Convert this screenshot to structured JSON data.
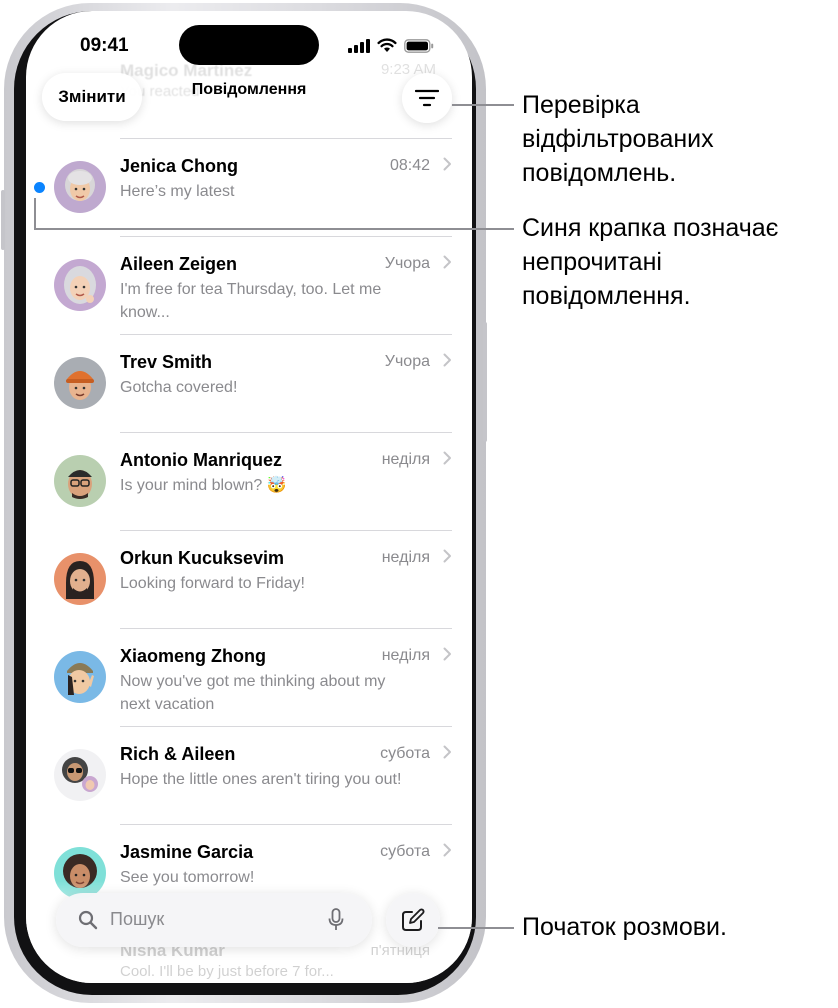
{
  "status_bar": {
    "time": "09:41"
  },
  "header": {
    "edit_label": "Змінити",
    "title": "Повідомлення",
    "ghost_name": "Magico Martinez",
    "ghost_preview": "You reacted",
    "ghost_time": "9:23 AM"
  },
  "conversations": [
    {
      "name": "Jenica Chong",
      "preview": "Here’s my latest",
      "time": "08:42",
      "unread": true,
      "avatar_bg": "#bfa9cf"
    },
    {
      "name": "Aileen Zeigen",
      "preview": "I'm free for tea Thursday, too. Let me know...",
      "time": "Учора",
      "unread": false,
      "avatar_bg": "#c3a8d1"
    },
    {
      "name": "Trev Smith",
      "preview": "Gotcha covered!",
      "time": "Учора",
      "unread": false,
      "avatar_bg": "#a9adb3"
    },
    {
      "name": "Antonio Manriquez",
      "preview": "Is your mind blown? 🤯",
      "time": "неділя",
      "unread": false,
      "avatar_bg": "#b9cfb0"
    },
    {
      "name": "Orkun Kucuksevim",
      "preview": "Looking forward to Friday!",
      "time": "неділя",
      "unread": false,
      "avatar_bg": "#e8916a"
    },
    {
      "name": "Xiaomeng Zhong",
      "preview": "Now you've got me thinking about my next vacation",
      "time": "неділя",
      "unread": false,
      "avatar_bg": "#7ab9e6"
    },
    {
      "name": "Rich & Aileen",
      "preview": "Hope the little ones aren't tiring you out!",
      "time": "субота",
      "unread": false,
      "avatar_bg": "#f1f1f3"
    },
    {
      "name": "Jasmine Garcia",
      "preview": "See you tomorrow!",
      "time": "субота",
      "unread": false,
      "avatar_bg": "#7fe0d8"
    }
  ],
  "bottom_ghost": {
    "name": "Nisha Kumar",
    "preview": "Cool. I'll be by just before 7 for...",
    "time": "п'ятниця"
  },
  "search": {
    "placeholder": "Пошук"
  },
  "callouts": {
    "filter": "Перевірка відфільтрованих повідомлень.",
    "unread": "Синя крапка позначає непрочитані повідомлення.",
    "compose": "Початок розмови."
  },
  "colors": {
    "unread_dot": "#0a84ff",
    "secondary_text": "#8a8a8e",
    "separator": "#d8d8dc"
  }
}
